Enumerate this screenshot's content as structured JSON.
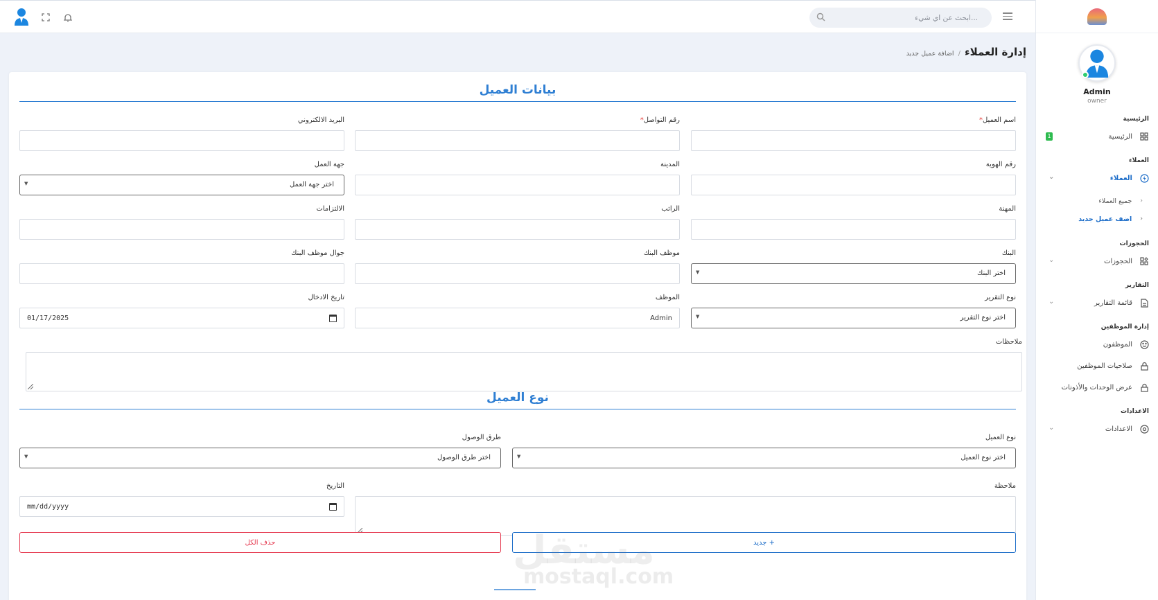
{
  "topbar": {
    "search_placeholder": "ابحث عن اي شيء..."
  },
  "sidebar": {
    "user_name": "Admin",
    "user_role": "owner",
    "sections": {
      "home": "الرئيسية",
      "clients": "العملاء",
      "bookings": "الحجوزات",
      "reports": "التقارير",
      "staff": "إدارة الموظفين",
      "settings": "الاعدادات"
    },
    "items": {
      "home": "الرئيسية",
      "home_badge": "1",
      "clients": "العملاء",
      "all_clients": "جميع العملاء",
      "add_client": "اضف عميل جديد",
      "bookings": "الحجوزات",
      "reports_list": "قائمة التقارير",
      "employees": "الموظفون",
      "permissions": "صلاحيات الموظفين",
      "units": "عرض الوحدات والأذونات",
      "settings": "الاعدادات"
    }
  },
  "breadcrumb": {
    "main": "إدارة العملاء",
    "sep": "/",
    "sub": "اضافة عميل جديد"
  },
  "client_data": {
    "title": "بيانات العميل",
    "fields": {
      "name": "اسم العميل",
      "phone": "رقم التواصل",
      "email": "البريد الالكتروني",
      "id_number": "رقم الهوية",
      "city": "المدينة",
      "employer": "جهة العمل",
      "employer_placeholder": "اختر جهة العمل",
      "profession": "المهنة",
      "salary": "الراتب",
      "obligations": "الالتزامات",
      "bank": "البنك",
      "bank_placeholder": "اختر البنك",
      "bank_employee": "موظف البنك",
      "bank_employee_phone": "جوال موظف البنك",
      "report_type": "نوع التقرير",
      "report_type_placeholder": "اختر نوع التقرير",
      "employee": "الموظف",
      "employee_value": "Admin",
      "entry_date": "تاريخ الادخال",
      "entry_date_value": "01/17/2025",
      "notes": "ملاحظات"
    }
  },
  "client_type": {
    "title": "نوع العميل",
    "fields": {
      "type": "نوع العميل",
      "type_placeholder": "اختر نوع العميل",
      "access": "طرق الوصول",
      "access_placeholder": "اختر طرق الوصول",
      "note": "ملاحظة",
      "date": "التاريخ",
      "date_placeholder": "mm/dd/yyyy"
    },
    "buttons": {
      "new": "جديد +",
      "delete_all": "حذف الكل"
    }
  },
  "watermark": {
    "arabic": "مستقل",
    "latin": "mostaql.com"
  },
  "colors": {
    "primary": "#2f7fd3",
    "danger": "#e53950",
    "badge": "#2ebb4f"
  }
}
